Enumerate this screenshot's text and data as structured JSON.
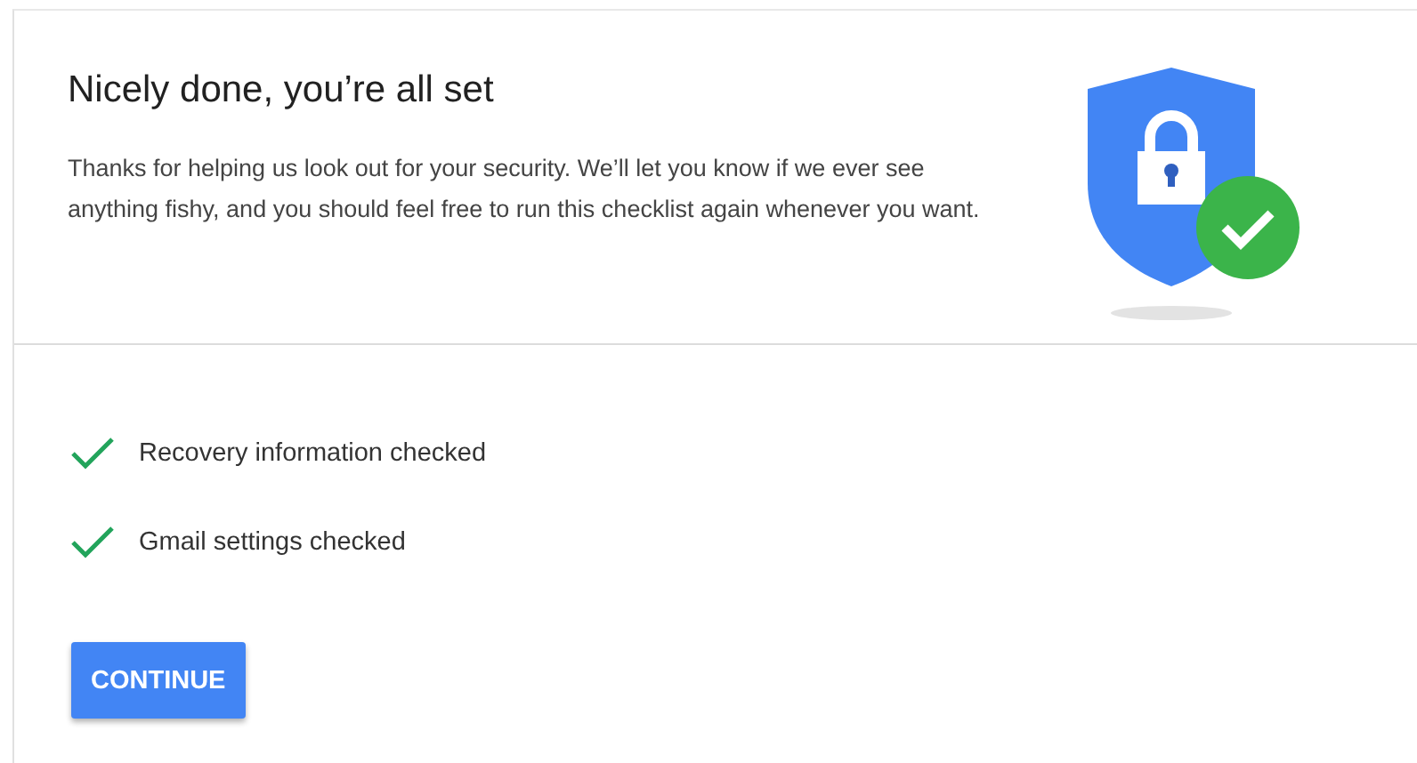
{
  "header": {
    "title": "Nicely done, you’re all set",
    "description": "Thanks for helping us look out for your security. We’ll let you know if we ever see anything fishy, and you should feel free to run this checklist again whenever you want."
  },
  "checklist": [
    {
      "label": "Recovery information checked",
      "checked": true
    },
    {
      "label": "Gmail settings checked",
      "checked": true
    }
  ],
  "button": {
    "label": "CONTINUE"
  }
}
